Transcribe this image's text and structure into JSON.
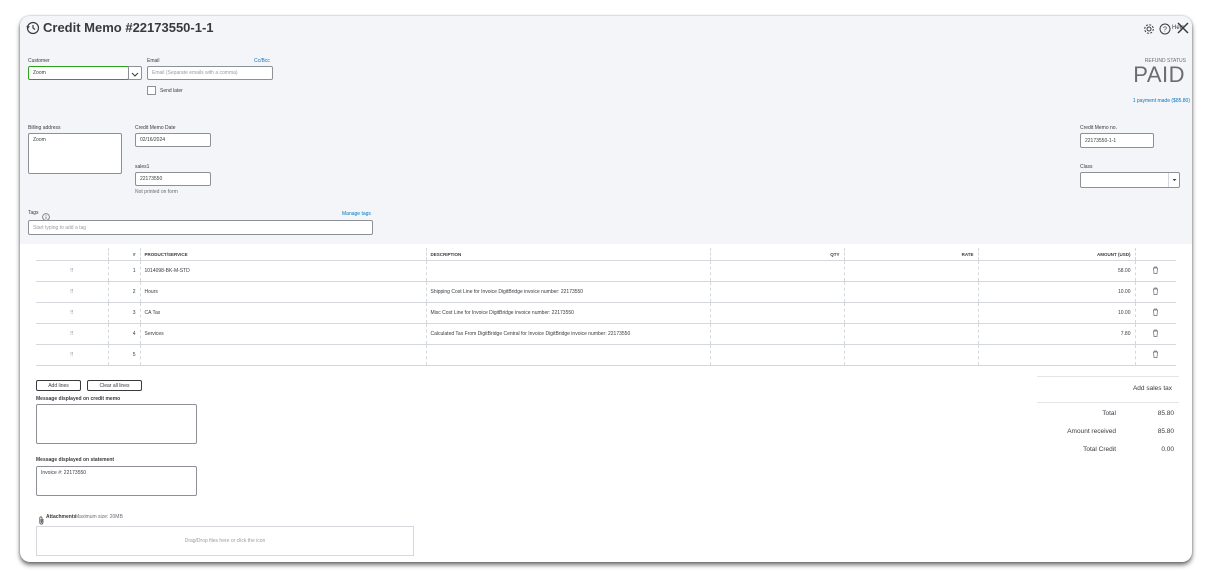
{
  "header": {
    "title": "Credit Memo #22173550-1-1",
    "help_label": "Help"
  },
  "customer": {
    "label": "Customer",
    "value": "Zoom"
  },
  "email": {
    "label": "Email",
    "ccbcc": "Cc/Bcc",
    "placeholder": "Email (Separate emails with a comma)",
    "send_later": "Send later"
  },
  "status": {
    "label": "REFUND STATUS",
    "value": "PAID",
    "payment_note": "1 payment made ($85.80)"
  },
  "billing": {
    "label": "Billing address",
    "value": "Zoom"
  },
  "memo_date": {
    "label": "Credit Memo Date",
    "value": "02/16/2024"
  },
  "sales": {
    "label": "sales1",
    "value": "22173550",
    "note": "Not printed on form"
  },
  "memo_no": {
    "label": "Credit Memo no.",
    "value": "22173550-1-1"
  },
  "class_field": {
    "label": "Class",
    "value": ""
  },
  "tags": {
    "label": "Tags",
    "manage": "Manage tags",
    "placeholder": "Start typing to add a tag"
  },
  "table": {
    "headers": {
      "num": "#",
      "product": "PRODUCT/SERVICE",
      "description": "DESCRIPTION",
      "qty": "QTY",
      "rate": "RATE",
      "amount": "AMOUNT (USD)"
    },
    "rows": [
      {
        "num": "1",
        "product": "1014098-BK-M-STD",
        "description": "",
        "qty": "",
        "rate": "",
        "amount": "58.00"
      },
      {
        "num": "2",
        "product": "Hours",
        "description": "Shipping Cost Line for Invoice DigitBridge invoice number: 22173550",
        "qty": "",
        "rate": "",
        "amount": "10.00"
      },
      {
        "num": "3",
        "product": "CA Tax",
        "description": "Misc Cost Line for Invoice DigitBridge invoice number: 22173550",
        "qty": "",
        "rate": "",
        "amount": "10.00"
      },
      {
        "num": "4",
        "product": "Services",
        "description": "Calculated Tax From DigitBridge Central for Invoice DigitBridge invoice number: 22173550",
        "qty": "",
        "rate": "",
        "amount": "7.80"
      },
      {
        "num": "5",
        "product": "",
        "description": "",
        "qty": "",
        "rate": "",
        "amount": ""
      }
    ]
  },
  "buttons": {
    "add_lines": "Add lines",
    "clear_lines": "Clear all lines"
  },
  "message_memo": {
    "label": "Message displayed on credit memo",
    "value": ""
  },
  "message_statement": {
    "label": "Message displayed on statement",
    "value": "Invoice #: 22173550"
  },
  "attachments": {
    "label": "Attachments",
    "max": "Maximum size: 20MB",
    "drop": "Drag/Drop files here or click the icon"
  },
  "totals": {
    "add_tax": "Add sales tax",
    "total_label": "Total",
    "total_value": "85.80",
    "received_label": "Amount received",
    "received_value": "85.80",
    "credit_label": "Total Credit",
    "credit_value": "0.00"
  }
}
